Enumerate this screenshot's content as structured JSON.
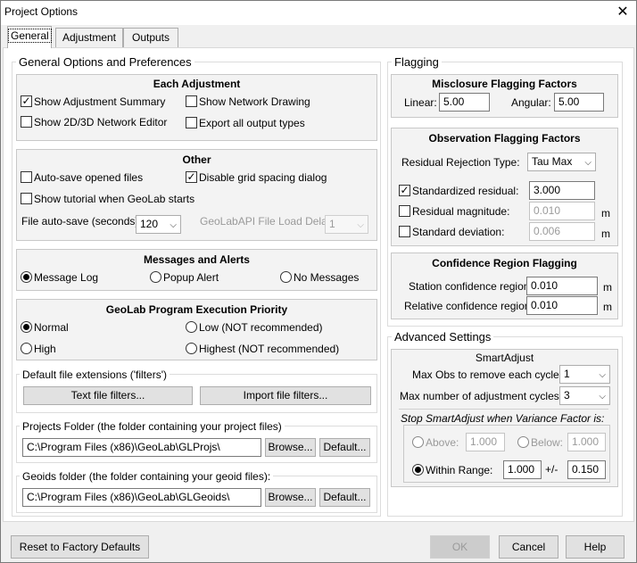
{
  "window": {
    "title": "Project Options",
    "close_glyph": "✕"
  },
  "tabs": [
    {
      "label": "General",
      "active": true
    },
    {
      "label": "Adjustment",
      "active": false
    },
    {
      "label": "Outputs",
      "active": false
    }
  ],
  "general": {
    "title": "General Options and Preferences",
    "each_adjustment": {
      "title": "Each Adjustment",
      "show_adjustment_summary": {
        "label": "Show Adjustment Summary",
        "checked": true
      },
      "show_network_drawing": {
        "label": "Show Network Drawing",
        "checked": false
      },
      "show_network_editor": {
        "label": "Show 2D/3D Network Editor",
        "checked": false
      },
      "export_all_outputs": {
        "label": "Export all output types",
        "checked": false
      }
    },
    "other": {
      "title": "Other",
      "auto_save": {
        "label": "Auto-save opened files",
        "checked": false
      },
      "disable_grid": {
        "label": "Disable grid spacing dialog",
        "checked": true
      },
      "show_tutorial": {
        "label": "Show tutorial when GeoLab starts",
        "checked": false
      },
      "file_autosave_label": "File auto-save (seconds):",
      "file_autosave_value": "120",
      "load_delay_label": "GeoLabAPI File Load Delay:",
      "load_delay_value": "1"
    },
    "messages": {
      "title": "Messages and Alerts",
      "message_log": "Message Log",
      "popup_alert": "Popup Alert",
      "no_messages": "No Messages",
      "selected": "message_log"
    },
    "priority": {
      "title": "GeoLab Program Execution Priority",
      "normal": "Normal",
      "low": "Low (NOT recommended)",
      "high": "High",
      "highest": "Highest (NOT recommended)",
      "selected": "normal"
    },
    "extensions": {
      "label": "Default file extensions ('filters')",
      "text_filters": "Text file filters...",
      "import_filters": "Import file filters..."
    },
    "projects_folder": {
      "label": "Projects Folder (the folder containing your project files)",
      "path": "C:\\Program Files (x86)\\GeoLab\\GLProjs\\",
      "browse": "Browse...",
      "default": "Default..."
    },
    "geoids_folder": {
      "label": "Geoids folder (the folder containing your geoid files):",
      "path": "C:\\Program Files (x86)\\GeoLab\\GLGeoids\\",
      "browse": "Browse...",
      "default": "Default..."
    }
  },
  "flagging": {
    "title": "Flagging",
    "misclosure": {
      "title": "Misclosure Flagging Factors",
      "linear_label": "Linear:",
      "linear_value": "5.00",
      "angular_label": "Angular:",
      "angular_value": "5.00"
    },
    "observation": {
      "title": "Observation Flagging Factors",
      "rejection_label": "Residual Rejection Type:",
      "rejection_value": "Tau Max",
      "standardized": {
        "label": "Standardized residual:",
        "checked": true,
        "value": "3.000"
      },
      "magnitude": {
        "label": "Residual magnitude:",
        "checked": false,
        "value": "0.010",
        "unit": "m"
      },
      "std_dev": {
        "label": "Standard deviation:",
        "checked": false,
        "value": "0.006",
        "unit": "m"
      }
    },
    "confidence": {
      "title": "Confidence Region Flagging",
      "station_label": "Station confidence region:",
      "station_value": "0.010",
      "station_unit": "m",
      "relative_label": "Relative confidence region:",
      "relative_value": "0.010",
      "relative_unit": "m"
    }
  },
  "advanced": {
    "title": "Advanced Settings",
    "smartadjust": "SmartAdjust",
    "max_obs_label": "Max Obs to remove each cycle:",
    "max_obs_value": "1",
    "max_cycles_label": "Max number of adjustment cycles:",
    "max_cycles_value": "3",
    "stop_label": "Stop SmartAdjust when Variance Factor is:",
    "above_label": "Above:",
    "above_value": "1.000",
    "below_label": "Below:",
    "below_value": "1.000",
    "within_label": "Within Range:",
    "within_value": "1.000",
    "pm_label": "+/-",
    "pm_value": "0.150",
    "selected": "within"
  },
  "footer": {
    "reset": "Reset to Factory Defaults",
    "ok": "OK",
    "cancel": "Cancel",
    "help": "Help"
  }
}
